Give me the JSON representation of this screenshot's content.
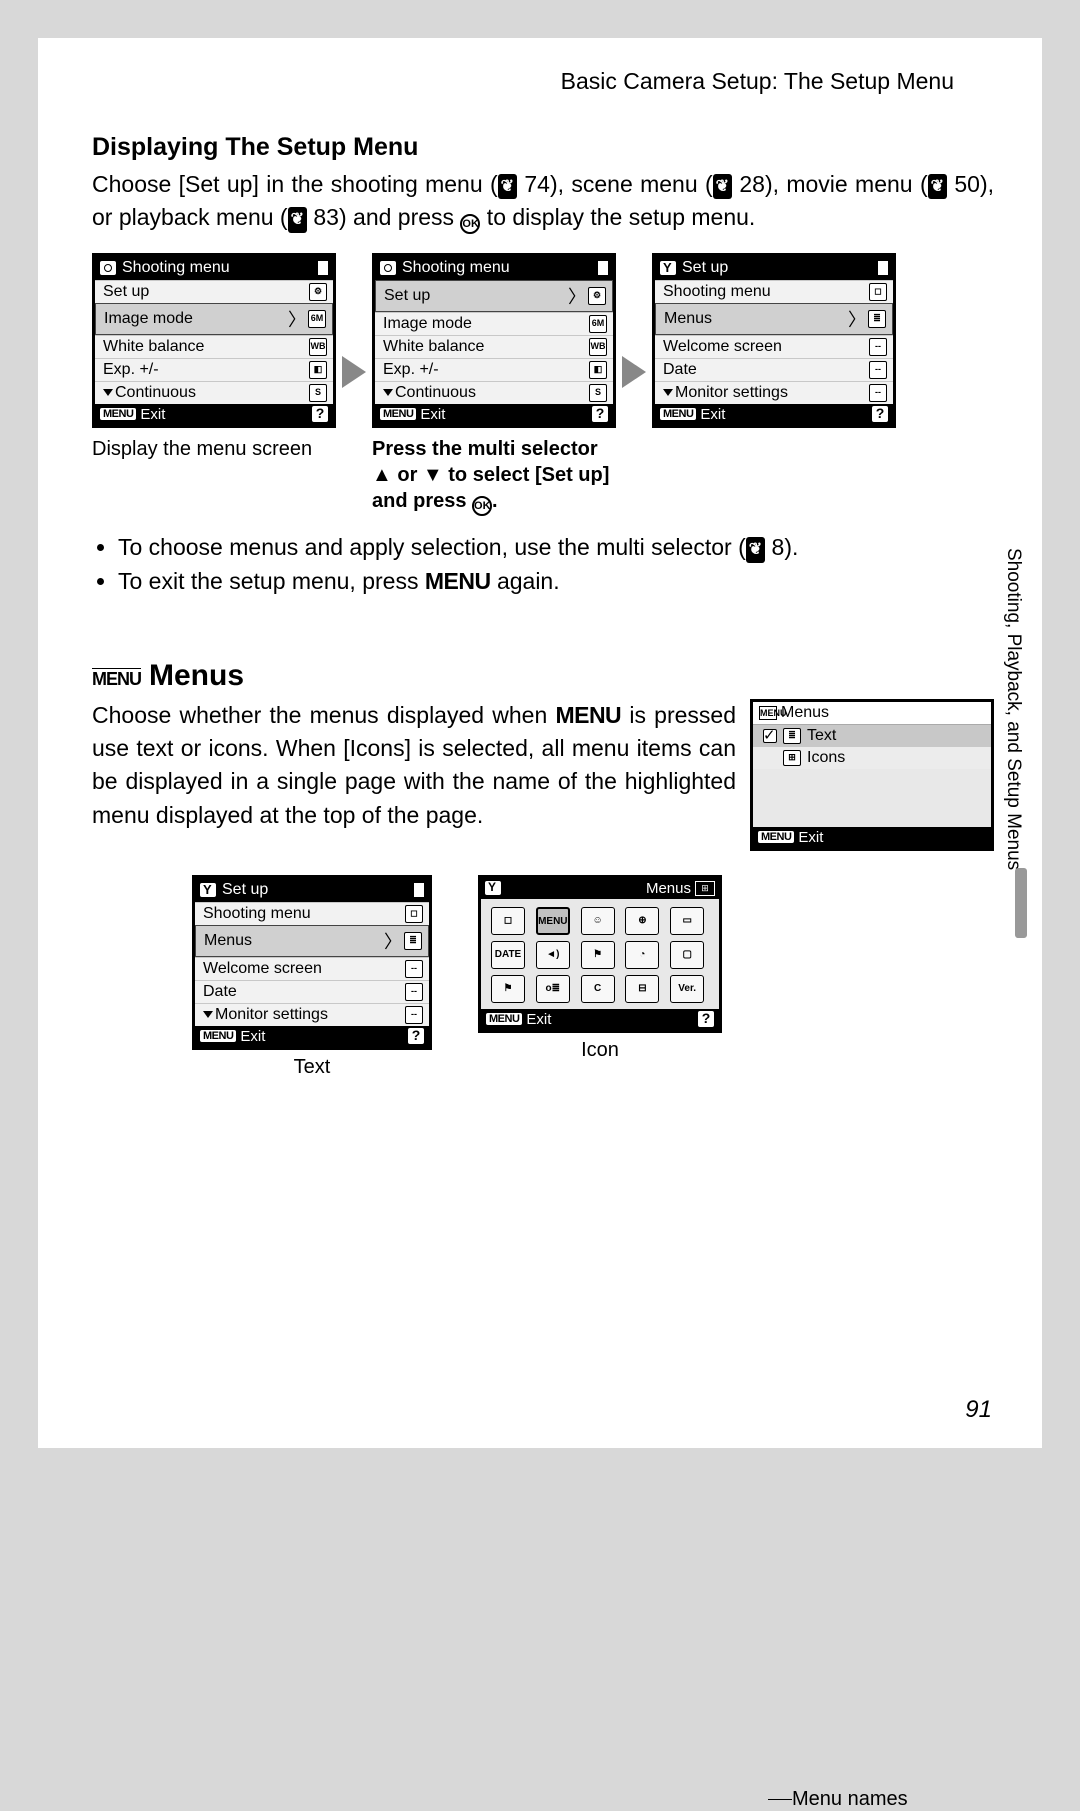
{
  "header": "Basic Camera Setup: The Setup Menu",
  "section1_title": "Displaying The Setup Menu",
  "para1_a": "Choose [Set up] in the shooting menu (",
  "para1_b": " 74), scene menu (",
  "para1_c": " 28), movie menu (",
  "para1_d": " 50), or playback menu (",
  "para1_e": " 83) and press ",
  "para1_f": " to display the setup menu.",
  "ok_label": "OK",
  "refglyph": "❦",
  "lcd1": {
    "title": "Shooting menu",
    "rows": [
      "Set up",
      "Image mode",
      "White balance",
      "Exp. +/-",
      "Continuous"
    ],
    "icons": [
      "⚙",
      "6M",
      "WB",
      "◧",
      "S"
    ]
  },
  "lcd2": {
    "title": "Shooting menu",
    "rows": [
      "Set up",
      "Image mode",
      "White balance",
      "Exp. +/-",
      "Continuous"
    ],
    "icons": [
      "⚙",
      "6M",
      "WB",
      "◧",
      "S"
    ]
  },
  "lcd3": {
    "title": "Set up",
    "rows": [
      "Shooting menu",
      "Menus",
      "Welcome screen",
      "Date",
      "Monitor settings"
    ],
    "icons": [
      "◻",
      "≣",
      "--",
      "--",
      "--"
    ]
  },
  "menu_btn": "MENU",
  "exit": "Exit",
  "q": "?",
  "cap1": "Display the menu screen",
  "cap2a": "Press the multi selector",
  "cap2b": "▲ or ▼ to select [Set up]",
  "cap2c": "and press ",
  "cap2d": ".",
  "bullet1_a": "To choose menus and apply selection, use the multi selector (",
  "bullet1_b": " 8).",
  "bullet2_a": "To exit the setup menu, press ",
  "bullet2_b": " again.",
  "menu_word": "MENU",
  "menus_heading_box": "MENU",
  "menus_heading": "Menus",
  "menus_para_a": "Choose whether the menus displayed when ",
  "menus_para_b": " is pressed use text or icons. When [Icons] is selected, all menu items can be displayed in a single page with the name of the highlighted menu displayed at the top of the page.",
  "menus_lcd_title": "Menus",
  "menus_opt1": "Text",
  "menus_opt2": "Icons",
  "lower_left": {
    "title": "Set up",
    "rows": [
      "Shooting menu",
      "Menus",
      "Welcome screen",
      "Date",
      "Monitor settings"
    ],
    "icons": [
      "◻",
      "≣",
      "--",
      "--",
      "--"
    ]
  },
  "lower_center_title": "Menus",
  "icon_grid": [
    "◻",
    "MENU",
    "☺",
    "⊕",
    "▭",
    "DATE",
    "◄)",
    "⚑",
    "◔",
    "▢",
    "⚑",
    "o≣",
    "C",
    "⊟",
    "Ver."
  ],
  "cap_text": "Text",
  "cap_icon": "Icon",
  "menu_names": "Menu names",
  "side_tab": "Shooting, Playback, and Setup Menus",
  "page_num": "91"
}
